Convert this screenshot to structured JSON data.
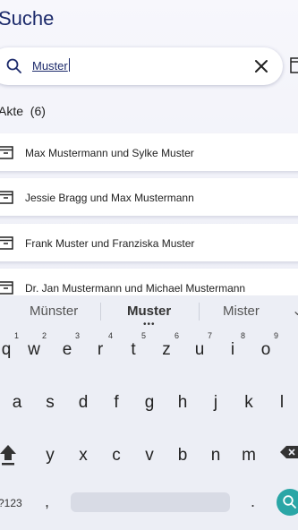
{
  "header": {
    "title": "Suche"
  },
  "search": {
    "value": "Muster"
  },
  "section": {
    "label": "Akte",
    "count": "(6)"
  },
  "results": [
    {
      "label": "Max Mustermann und Sylke Muster"
    },
    {
      "label": "Jessie Bragg und Max Mustermann"
    },
    {
      "label": "Frank Muster und Franziska Muster"
    },
    {
      "label": "Dr. Jan Mustermann und Michael Mustermann"
    }
  ],
  "keyboard": {
    "suggestions": [
      "Münster",
      "Muster",
      "Mister"
    ],
    "row1": [
      {
        "char": "q",
        "hint": "1"
      },
      {
        "char": "w",
        "hint": "2"
      },
      {
        "char": "e",
        "hint": "3"
      },
      {
        "char": "r",
        "hint": "4"
      },
      {
        "char": "t",
        "hint": "5"
      },
      {
        "char": "z",
        "hint": "6"
      },
      {
        "char": "u",
        "hint": "7"
      },
      {
        "char": "i",
        "hint": "8"
      },
      {
        "char": "o",
        "hint": "9"
      }
    ],
    "row2": [
      "a",
      "s",
      "d",
      "f",
      "g",
      "h",
      "j",
      "k",
      "l"
    ],
    "row3": [
      "y",
      "x",
      "c",
      "v",
      "b",
      "n",
      "m"
    ],
    "symbols_label": "?123",
    "comma": ",",
    "period": "."
  },
  "colors": {
    "accent": "#1c2a6b",
    "fab": "#2aa6a6"
  }
}
